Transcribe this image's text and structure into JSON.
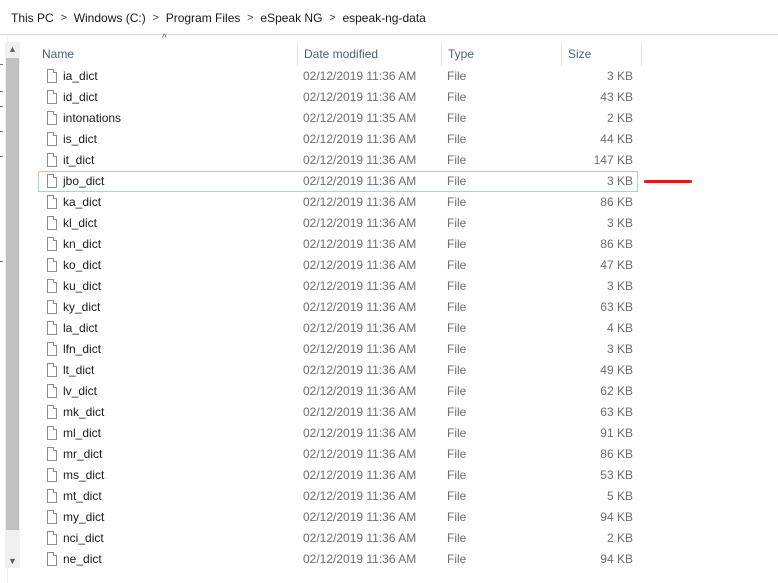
{
  "breadcrumb": [
    "This PC",
    "Windows (C:)",
    "Program Files",
    "eSpeak NG",
    "espeak-ng-data"
  ],
  "breadcrumb_separator": ">",
  "columns": {
    "name": "Name",
    "date": "Date modified",
    "type": "Type",
    "size": "Size"
  },
  "sort_indicator": "^",
  "scroll_up_glyph": "▲",
  "scroll_down_glyph": "▼",
  "files": [
    {
      "name": "ia_dict",
      "date": "02/12/2019 11:36 AM",
      "type": "File",
      "size": "3 KB"
    },
    {
      "name": "id_dict",
      "date": "02/12/2019 11:36 AM",
      "type": "File",
      "size": "43 KB"
    },
    {
      "name": "intonations",
      "date": "02/12/2019 11:35 AM",
      "type": "File",
      "size": "2 KB"
    },
    {
      "name": "is_dict",
      "date": "02/12/2019 11:36 AM",
      "type": "File",
      "size": "44 KB"
    },
    {
      "name": "it_dict",
      "date": "02/12/2019 11:36 AM",
      "type": "File",
      "size": "147 KB"
    },
    {
      "name": "jbo_dict",
      "date": "02/12/2019 11:36 AM",
      "type": "File",
      "size": "3 KB"
    },
    {
      "name": "ka_dict",
      "date": "02/12/2019 11:36 AM",
      "type": "File",
      "size": "86 KB"
    },
    {
      "name": "kl_dict",
      "date": "02/12/2019 11:36 AM",
      "type": "File",
      "size": "3 KB"
    },
    {
      "name": "kn_dict",
      "date": "02/12/2019 11:36 AM",
      "type": "File",
      "size": "86 KB"
    },
    {
      "name": "ko_dict",
      "date": "02/12/2019 11:36 AM",
      "type": "File",
      "size": "47 KB"
    },
    {
      "name": "ku_dict",
      "date": "02/12/2019 11:36 AM",
      "type": "File",
      "size": "3 KB"
    },
    {
      "name": "ky_dict",
      "date": "02/12/2019 11:36 AM",
      "type": "File",
      "size": "63 KB"
    },
    {
      "name": "la_dict",
      "date": "02/12/2019 11:36 AM",
      "type": "File",
      "size": "4 KB"
    },
    {
      "name": "lfn_dict",
      "date": "02/12/2019 11:36 AM",
      "type": "File",
      "size": "3 KB"
    },
    {
      "name": "lt_dict",
      "date": "02/12/2019 11:36 AM",
      "type": "File",
      "size": "49 KB"
    },
    {
      "name": "lv_dict",
      "date": "02/12/2019 11:36 AM",
      "type": "File",
      "size": "62 KB"
    },
    {
      "name": "mk_dict",
      "date": "02/12/2019 11:36 AM",
      "type": "File",
      "size": "63 KB"
    },
    {
      "name": "ml_dict",
      "date": "02/12/2019 11:36 AM",
      "type": "File",
      "size": "91 KB"
    },
    {
      "name": "mr_dict",
      "date": "02/12/2019 11:36 AM",
      "type": "File",
      "size": "86 KB"
    },
    {
      "name": "ms_dict",
      "date": "02/12/2019 11:36 AM",
      "type": "File",
      "size": "53 KB"
    },
    {
      "name": "mt_dict",
      "date": "02/12/2019 11:36 AM",
      "type": "File",
      "size": "5 KB"
    },
    {
      "name": "my_dict",
      "date": "02/12/2019 11:36 AM",
      "type": "File",
      "size": "94 KB"
    },
    {
      "name": "nci_dict",
      "date": "02/12/2019 11:36 AM",
      "type": "File",
      "size": "2 KB"
    },
    {
      "name": "ne_dict",
      "date": "02/12/2019 11:36 AM",
      "type": "File",
      "size": "94 KB"
    }
  ],
  "focused_file": "jbo_dict",
  "colors": {
    "focus_border": "#99d1ff",
    "annotation_mark": "#d81b1b",
    "header_text": "#4c607a",
    "scroll_thumb": "#c1c1c1"
  }
}
